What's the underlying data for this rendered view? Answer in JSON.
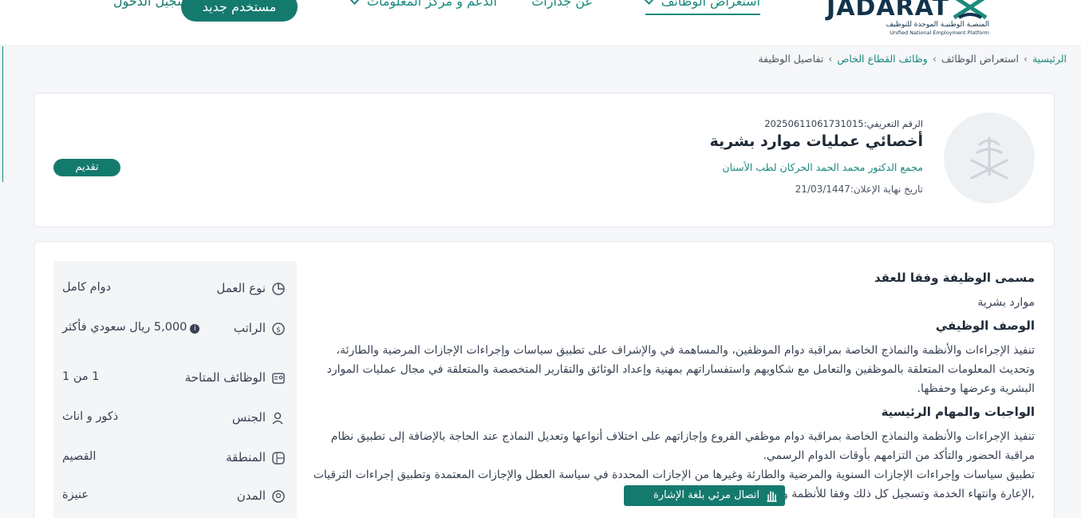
{
  "header": {
    "logo_text": "JADARAT",
    "logo_ar": "المنصـة الوطنيـة الموحدة للتوظيف",
    "logo_en": "Unified National Employment Platform",
    "nav": [
      {
        "label": "استعراض الوظائف"
      },
      {
        "label": "عن جدارات"
      },
      {
        "label": "الدعم و مركز المعلومات"
      }
    ],
    "new_user_label": "مستخدم جديد",
    "login_label": "تسجيل الدخول"
  },
  "breadcrumb": {
    "items": [
      "الرئيسية",
      "استعراض الوظائف",
      "وظائف القطاع الخاص",
      "تفاصيل الوظيفة"
    ]
  },
  "job": {
    "id_line": "الرقم التعريفي:20250611061731015",
    "title": "أخصائي عمليات موارد بشرية",
    "company": "مجمع الدكتور محمد الحمد الحركان لطب الأسنان",
    "deadline": "تاريخ نهاية الإعلان:21/03/1447",
    "apply_label": "تقديم"
  },
  "details": [
    {
      "label": "نوع العمل",
      "value": "دوام كامل",
      "icon": "pie-chart-icon"
    },
    {
      "label": "الراتب",
      "value": "5,000 ريال سعودي فأكثر",
      "icon": "money-icon"
    },
    {
      "label": "الوظائف المتاحة",
      "value": "1 من 1",
      "icon": "id-card-icon"
    },
    {
      "label": "الجنس",
      "value": "ذكور و اناث",
      "icon": "gender-icon"
    },
    {
      "label": "المنطقة",
      "value": "القصيم",
      "icon": "map-icon"
    },
    {
      "label": "المدن",
      "value": "عنيزة",
      "icon": "location-icon"
    }
  ],
  "content": {
    "contract_title_heading": "مسمى الوظيفة وفقا للعقد",
    "contract_title": "موارد بشرية",
    "desc_heading": "الوصف الوظيفي",
    "desc": "تنفيذ الإجراءات والأنظمة والنماذج الخاصة بمراقبة دوام الموظفين، والمساهمة في والإشراف على تطبيق سياسات وإجراءات الإجازات المرضية والطارئة، وتحديث المعلومات المتعلقة بالموظفين والتعامل مع شكاويهم واستفساراتهم بمهنية وإعداد الوثائق والتقارير المتخصصة والمتعلقة في مجال عمليات الموارد البشرية وعرضها وحفظها.",
    "duties_heading": "الواجبات والمهام الرئيسية",
    "duty1": "تنفيذ الإجراءات والأنظمة والنماذج الخاصة بمراقبة دوام موظفي الفروع وإجازاتهم على اختلاف أنواعها وتعديل النماذج عند الحاجة بالإضافة إلى تطبيق نظام مراقبة الحضور والتأكد من التزامهم بأوقات الدوام الرسمي.",
    "duty2": "تطبيق سياسات وإجراءات الإجازات السنوية والمرضية والطارئة وغيرها من الإجازات المحددة في سياسة العطل والإجازات المعتمدة وتطبيق إجراءات الترقيات ,الإعارة وانتهاء الخدمة وتسجيل كل ذلك وفقا للأنظمة والإجراءات المعتمدة."
  },
  "sign_language_label": "اتصال مرئي بلغة الإشارة",
  "colors": {
    "accent": "#157a6e",
    "link": "#1b8a7d"
  }
}
